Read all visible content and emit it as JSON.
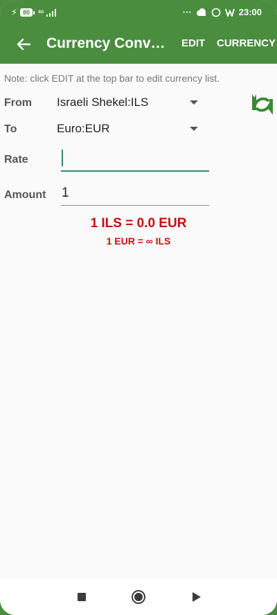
{
  "status_bar": {
    "battery": "80",
    "network": "4G",
    "dots": "···",
    "time": "23:00"
  },
  "app_bar": {
    "title": "Currency Converter",
    "edit_label": "EDIT",
    "currency_label": "CURRENCY"
  },
  "note": "Note: click EDIT at the top bar to edit currency list.",
  "form": {
    "from_label": "From",
    "from_value": "Israeli Shekel:ILS",
    "to_label": "To",
    "to_value": "Euro:EUR",
    "rate_label": "Rate",
    "rate_value": "",
    "amount_label": "Amount",
    "amount_value": "1"
  },
  "result": {
    "main": "1 ILS = 0.0 EUR",
    "inverse": "1 EUR = ∞ ILS"
  },
  "icons": {
    "back": "arrow-back-icon",
    "swap": "swap-icon",
    "nav_recent": "square-icon",
    "nav_home": "circle-icon",
    "nav_back": "triangle-icon"
  },
  "colors": {
    "primary": "#4a8d3f",
    "accent": "#2a8a78",
    "result": "#c40f0f"
  }
}
